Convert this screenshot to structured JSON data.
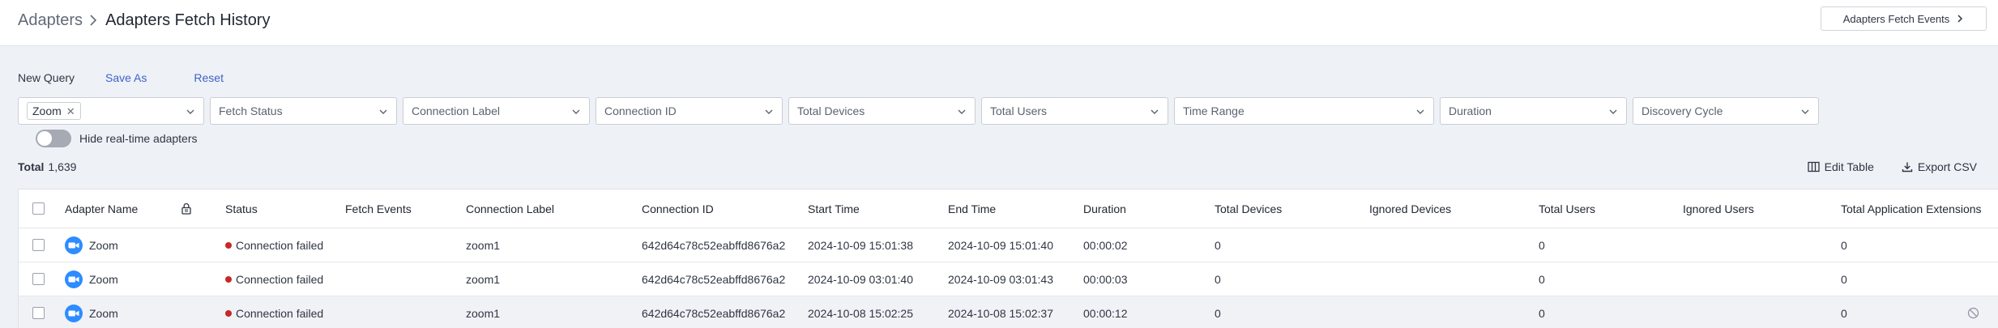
{
  "header": {
    "breadcrumb_root": "Adapters",
    "breadcrumb_current": "Adapters Fetch History",
    "fetch_events_label": "Adapters Fetch Events"
  },
  "query": {
    "new_query": "New Query",
    "save_as": "Save As",
    "reset": "Reset"
  },
  "filters": [
    {
      "name": "adapter-filter",
      "label": "",
      "chip": "Zoom"
    },
    {
      "name": "fetch-status-filter",
      "label": "Fetch Status"
    },
    {
      "name": "connection-label-filter",
      "label": "Connection Label"
    },
    {
      "name": "connection-id-filter",
      "label": "Connection ID"
    },
    {
      "name": "total-devices-filter",
      "label": "Total Devices"
    },
    {
      "name": "total-users-filter",
      "label": "Total Users"
    },
    {
      "name": "time-range-filter",
      "label": "Time Range"
    },
    {
      "name": "duration-filter",
      "label": "Duration"
    },
    {
      "name": "discovery-cycle-filter",
      "label": "Discovery Cycle"
    }
  ],
  "toggle": {
    "label": "Hide real-time adapters",
    "on": false
  },
  "total": {
    "label": "Total",
    "value": "1,639"
  },
  "table_actions": {
    "edit_table": "Edit Table",
    "export_csv": "Export CSV"
  },
  "table": {
    "columns": [
      "Adapter Name",
      "Status",
      "Fetch Events",
      "Connection Label",
      "Connection ID",
      "Start Time",
      "End Time",
      "Duration",
      "Total Devices",
      "Ignored Devices",
      "Total Users",
      "Ignored Users",
      "Total Application Extensions"
    ],
    "rows": [
      {
        "adapter": "Zoom",
        "status": "Connection failed",
        "fetch_events": "",
        "connection_label": "zoom1",
        "connection_id": "642d64c78c52eabffd8676a2",
        "start_time": "2024-10-09 15:01:38",
        "end_time": "2024-10-09 15:01:40",
        "duration": "00:00:02",
        "total_devices": "0",
        "ignored_devices": "",
        "total_users": "0",
        "ignored_users": "",
        "total_app_ext": "0"
      },
      {
        "adapter": "Zoom",
        "status": "Connection failed",
        "fetch_events": "",
        "connection_label": "zoom1",
        "connection_id": "642d64c78c52eabffd8676a2",
        "start_time": "2024-10-09 03:01:40",
        "end_time": "2024-10-09 03:01:43",
        "duration": "00:00:03",
        "total_devices": "0",
        "ignored_devices": "",
        "total_users": "0",
        "ignored_users": "",
        "total_app_ext": "0"
      },
      {
        "adapter": "Zoom",
        "status": "Connection failed",
        "fetch_events": "",
        "connection_label": "zoom1",
        "connection_id": "642d64c78c52eabffd8676a2",
        "start_time": "2024-10-08 15:02:25",
        "end_time": "2024-10-08 15:02:37",
        "duration": "00:00:12",
        "total_devices": "0",
        "ignored_devices": "",
        "total_users": "0",
        "ignored_users": "",
        "total_app_ext": "0"
      }
    ]
  },
  "colors": {
    "link": "#3d63c9",
    "status_failed": "#c62828",
    "zoom_brand": "#2d8cff"
  }
}
